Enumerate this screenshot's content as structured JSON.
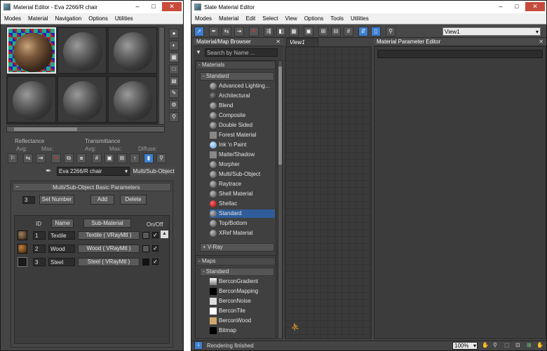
{
  "left_window": {
    "title": "Material Editor - Eva 2266/R chair",
    "menu": [
      "Modes",
      "Material",
      "Navigation",
      "Options",
      "Utilities"
    ],
    "slot_labels": {
      "reflectance": "Reflectance",
      "transmittance": "Transmittance",
      "avg": "Avg:",
      "max": "Max:",
      "diffuse": "Diffuse:"
    },
    "material_name": "Eva 2266/R chair",
    "material_type": "Multi/Sub-Object",
    "rollout_title": "Multi/Sub-Object Basic Parameters",
    "num_slots": "3",
    "buttons": {
      "set_number": "Set Number",
      "add": "Add",
      "delete": "Delete"
    },
    "columns": {
      "id": "ID",
      "name": "Name",
      "sub_material": "Sub-Material",
      "onoff": "On/Off"
    },
    "rows": [
      {
        "id": "1",
        "name": "Textile",
        "sub": "Textile  ( VRayMtl )",
        "color": "#5a5a5a"
      },
      {
        "id": "2",
        "name": "Wood",
        "sub": "Wood  ( VRayMtl )",
        "color": "#5a5a5a"
      },
      {
        "id": "3",
        "name": "Steel",
        "sub": "Steel  ( VRayMtl )",
        "color": "#111111"
      }
    ]
  },
  "right_window": {
    "title": "Slate Material Editor",
    "menu": [
      "Modes",
      "Material",
      "Edit",
      "Select",
      "View",
      "Options",
      "Tools",
      "Utilities"
    ],
    "view_select": "View1",
    "browser_title": "Material/Map Browser",
    "search_placeholder": "Search by Name ...",
    "materials_header": "- Materials",
    "standard_header": "- Standard",
    "materials": [
      "Advanced Lighting...",
      "Architectural",
      "Blend",
      "Composite",
      "Double Sided",
      "Forest Material",
      "Ink 'n Paint",
      "Matte/Shadow",
      "Morpher",
      "Multi/Sub-Object",
      "Raytrace",
      "Shell Material",
      "Shellac",
      "Standard",
      "Top/Bottom",
      "XRef Material"
    ],
    "selected_material": "Standard",
    "vray_header": "+ V-Ray",
    "maps_header": "- Maps",
    "maps_standard_header": "- Standard",
    "maps": [
      "BerconGradient",
      "BerconMapping",
      "BerconNoise",
      "BerconTile",
      "BerconWood",
      "Bitmap"
    ],
    "view_tab": "View1",
    "param_editor_title": "Material Parameter Editor",
    "status": "Rendering finished",
    "zoom": "100%"
  }
}
